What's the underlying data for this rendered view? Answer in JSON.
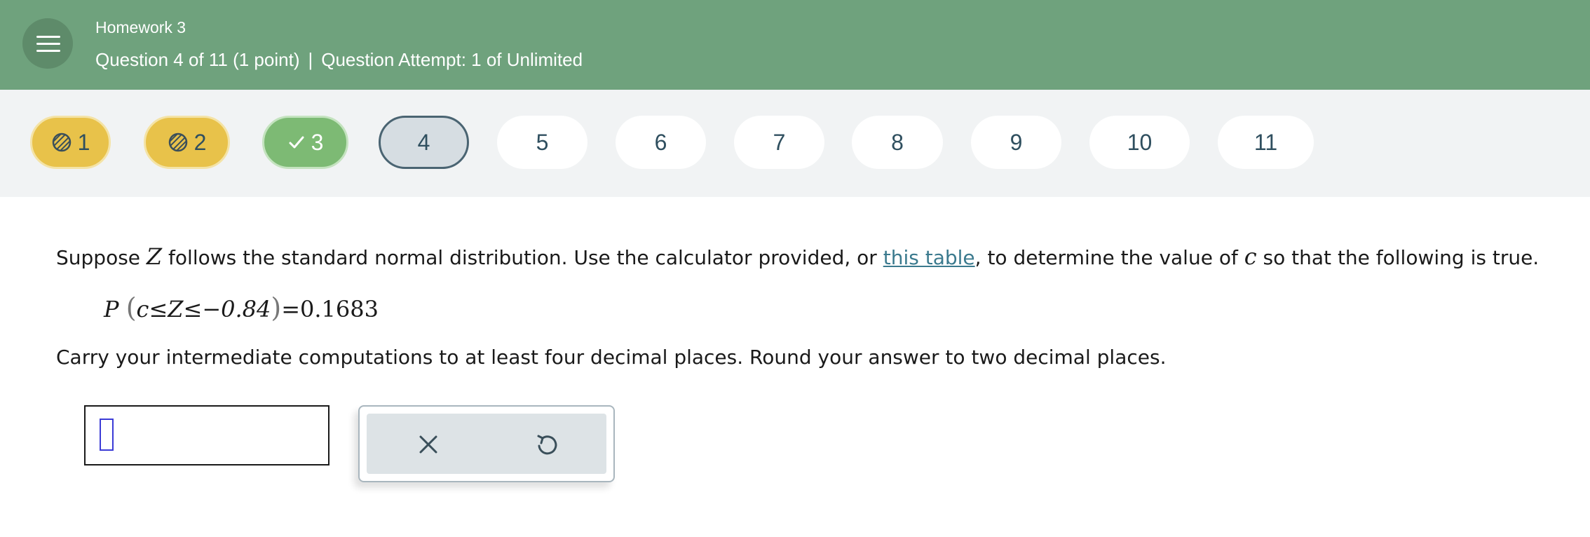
{
  "header": {
    "assignment_title": "Homework 3",
    "question_info": "Question 4 of 11 (1 point)",
    "separator": "|",
    "attempt_info": "Question Attempt: 1 of Unlimited",
    "menu_icon": "hamburger-menu-icon",
    "background_color": "#6fa27d"
  },
  "question_nav": {
    "items": [
      {
        "label": "1",
        "status": "partial",
        "icon": "striped-circle-icon"
      },
      {
        "label": "2",
        "status": "partial",
        "icon": "striped-circle-icon"
      },
      {
        "label": "3",
        "status": "correct",
        "icon": "checkmark-icon"
      },
      {
        "label": "4",
        "status": "current"
      },
      {
        "label": "5",
        "status": "unanswered"
      },
      {
        "label": "6",
        "status": "unanswered"
      },
      {
        "label": "7",
        "status": "unanswered"
      },
      {
        "label": "8",
        "status": "unanswered"
      },
      {
        "label": "9",
        "status": "unanswered"
      },
      {
        "label": "10",
        "status": "unanswered"
      },
      {
        "label": "11",
        "status": "unanswered"
      }
    ],
    "colors": {
      "partial": "#e8c24a",
      "correct": "#7dba74",
      "current": "#d6dde2"
    }
  },
  "problem": {
    "text_1": "Suppose ",
    "var_z": "Z",
    "text_2": " follows the standard normal distribution. Use the calculator provided, or ",
    "link_text": "this table",
    "text_3": ", to determine the value of ",
    "var_c": "c",
    "text_4": " so that the following is true.",
    "equation": {
      "p": "P",
      "open_paren": "(",
      "body": "c≤Z≤−0.84",
      "close_paren": ")",
      "rhs": "=0.1683"
    },
    "instructions": "Carry your intermediate computations to at least four decimal places. Round your answer to two decimal places."
  },
  "answer": {
    "value": "",
    "tools": {
      "clear_icon": "close-x-icon",
      "undo_icon": "undo-icon"
    }
  }
}
